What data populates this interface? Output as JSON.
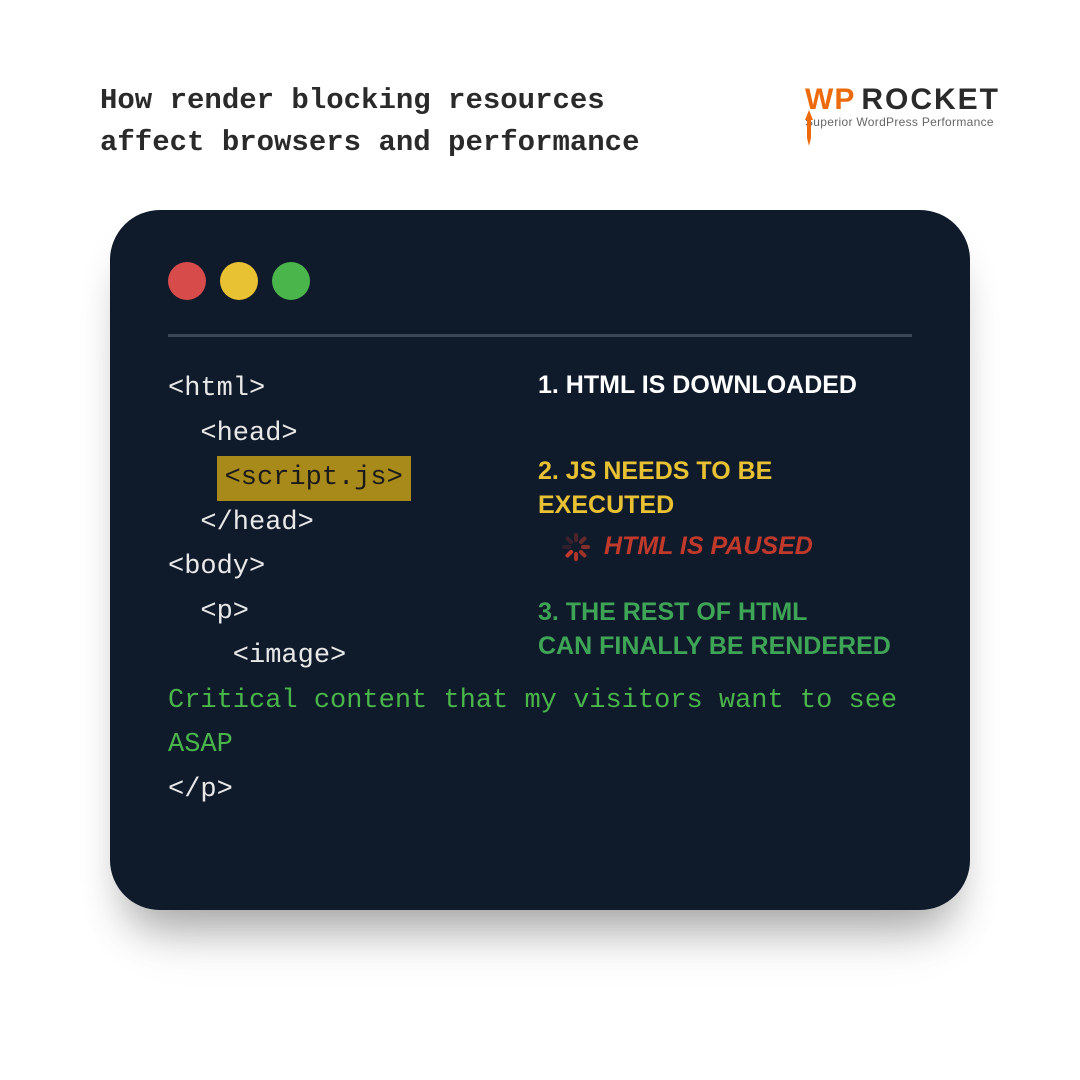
{
  "header": {
    "title_line1": "How render blocking resources",
    "title_line2": "affect browsers and performance"
  },
  "brand": {
    "wp": "WP",
    "rocket": "ROCKET",
    "tagline": "Superior WordPress Performance"
  },
  "terminal": {
    "traffic_colors": {
      "red": "#d84b4b",
      "yellow": "#e8c233",
      "green": "#4ab54a"
    }
  },
  "code": {
    "l1": "<html>",
    "l2": "  <head>",
    "l3_highlight": "<script.js>",
    "l4": "  </head>",
    "l5": "<body>",
    "l6": "  <p>",
    "l7": "    <image>",
    "critical": "Critical content that my visitors want to see ASAP",
    "l8": "</p>"
  },
  "steps": {
    "s1_label": "1. HTML IS DOWNLOADED",
    "s2_label": "2. JS NEEDS TO BE EXECUTED",
    "s2_sub": "HTML IS PAUSED",
    "s3_line1": "3. THE REST OF HTML",
    "s3_line2": "CAN FINALLY BE RENDERED"
  },
  "colors": {
    "terminal_bg": "#0f1a2b",
    "highlight_bg": "#a88a1a",
    "step1": "#ffffff",
    "step2": "#e8c233",
    "step2_sub": "#c0392b",
    "step3": "#3fa556",
    "critical_text": "#4ab54a",
    "brand_orange": "#ed6a0c"
  }
}
